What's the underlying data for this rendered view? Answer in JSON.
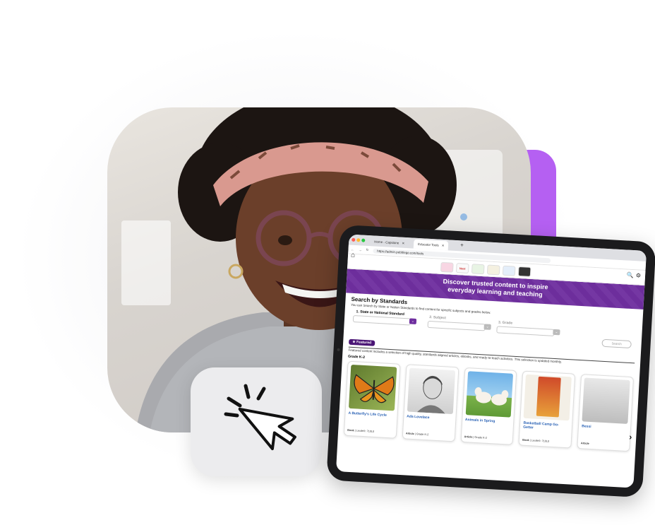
{
  "browser": {
    "tabs": [
      {
        "label": "Home - Capstone"
      },
      {
        "label": "Educator Tools"
      }
    ],
    "url": "https://admin.pebblego.com/tools"
  },
  "apps": {
    "next_label": "Next"
  },
  "hero": {
    "line1": "Discover trusted content to inspire",
    "line2": "everyday learning and teaching"
  },
  "search_standards": {
    "heading": "Search by Standards",
    "description": "You can Search by State or Nation Standards to find content for specific subjects and grades below.",
    "step1_label": "1. State or National Standard",
    "step2_label": "2. Subject",
    "step3_label": "3. Grade",
    "search_button": "Search"
  },
  "featured": {
    "badge": "★ Featured",
    "description": "Featured content includes a selection of high quality, standards aligned articles, eBooks, and ready-to-teach activities. This selection is updated monthly.",
    "grade_label": "Grade K-2",
    "cards": [
      {
        "title": "A Butterfly's Life Cycle",
        "type": "Book",
        "meta": "Lexile®: 710L0"
      },
      {
        "title": "Ada Lovelace",
        "type": "Article",
        "meta": "Grade K-2"
      },
      {
        "title": "Animals in Spring",
        "type": "Article",
        "meta": "Grade K-2"
      },
      {
        "title": "Basketball Camp Go-Getter",
        "type": "Book",
        "meta": "Lexile®: 710L0"
      },
      {
        "title": "Bessi",
        "type": "Article",
        "meta": ""
      }
    ]
  },
  "colors": {
    "purple_brand": "#6f2f9f",
    "purple_accent": "#b560f2",
    "featured_badge": "#4a1575",
    "link_blue": "#2a62b5"
  },
  "icons": [
    "home-icon",
    "search-icon",
    "gear-icon",
    "chevron-down-icon",
    "cursor-click-icon",
    "chevron-right-icon"
  ]
}
